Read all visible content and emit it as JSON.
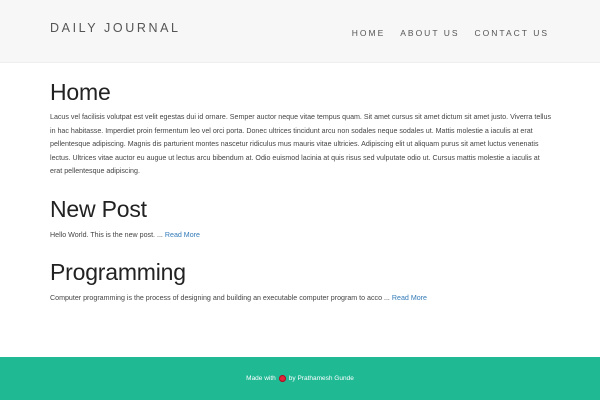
{
  "header": {
    "brand": "DAILY JOURNAL",
    "nav": [
      {
        "label": "HOME"
      },
      {
        "label": "ABOUT US"
      },
      {
        "label": "CONTACT US"
      }
    ]
  },
  "home": {
    "title": "Home",
    "body": "Lacus vel facilisis volutpat est velit egestas dui id ornare. Semper auctor neque vitae tempus quam. Sit amet cursus sit amet dictum sit amet justo. Viverra tellus in hac habitasse. Imperdiet proin fermentum leo vel orci porta. Donec ultrices tincidunt arcu non sodales neque sodales ut. Mattis molestie a iaculis at erat pellentesque adipiscing. Magnis dis parturient montes nascetur ridiculus mus mauris vitae ultricies. Adipiscing elit ut aliquam purus sit amet luctus venenatis lectus. Ultrices vitae auctor eu augue ut lectus arcu bibendum at. Odio euismod lacinia at quis risus sed vulputate odio ut. Cursus mattis molestie a iaculis at erat pellentesque adipiscing."
  },
  "posts": [
    {
      "title": "New Post",
      "excerpt": "Hello World. This is the new post. ...",
      "read_more": "Read More"
    },
    {
      "title": "Programming",
      "excerpt": "Computer programming is the process of designing and building an executable computer program to acco ...",
      "read_more": "Read More"
    }
  ],
  "footer": {
    "made_with": "Made with",
    "heart_icon": "heart-icon",
    "by": "by Prathamesh Gunde",
    "heart_color": "#e0263a",
    "background_color": "#1fb994"
  }
}
